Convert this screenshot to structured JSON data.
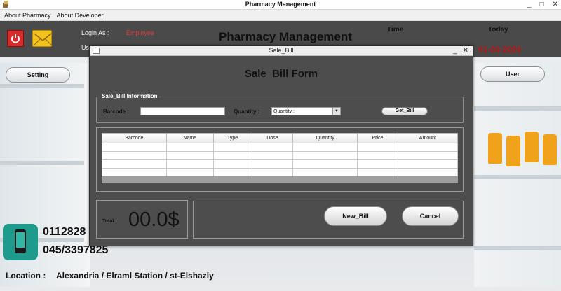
{
  "window": {
    "title": "Pharmacy Management",
    "controls": [
      "_",
      "□",
      "✕"
    ]
  },
  "menu": {
    "items": [
      "About Pharmacy",
      "About Developer"
    ]
  },
  "header": {
    "login_label": "Login As :",
    "login_role": "Employee",
    "user_label_partial": "Us",
    "app_title": "Pharmacy Management",
    "time_label": "Time",
    "today_label": "Today",
    "date": "01-04-2020"
  },
  "side": {
    "setting_label": "Setting",
    "user_label": "User"
  },
  "contact": {
    "phone1_partial": "0112828",
    "phone2": "045/3397825",
    "location_label": "Location :",
    "location_value": "Alexandria / Elraml Station / st-Elshazly"
  },
  "dialog": {
    "title": "Sale_Bill",
    "controls": [
      "_",
      "✕"
    ],
    "heading": "Sale_Bill Form",
    "info_legend": "Sale_Bill Information",
    "barcode_label": "Barcode :",
    "barcode_value": "",
    "quantity_label": "Quantity :",
    "quantity_selected": "Quantity :",
    "get_bill_label": "Get_Bill",
    "table": {
      "columns": [
        "Barcode",
        "Name",
        "Type",
        "Dose",
        "Quantity",
        "Price",
        "Amount"
      ],
      "rows": [
        [
          "",
          "",
          "",
          "",
          "",
          "",
          ""
        ],
        [
          "",
          "",
          "",
          "",
          "",
          "",
          ""
        ],
        [
          "",
          "",
          "",
          "",
          "",
          "",
          ""
        ],
        [
          "",
          "",
          "",
          "",
          "",
          "",
          ""
        ]
      ]
    },
    "total_label": "Total :",
    "total_value": "00.0$",
    "new_bill_label": "New_Bill",
    "cancel_label": "Cancel"
  },
  "colors": {
    "header_bg": "#4a4a4a",
    "dialog_bg": "#4d4d4d",
    "role_text": "#e23a3a",
    "date_text": "#c01212",
    "power_button": "#d42b2b",
    "mail_button": "#f3c21c",
    "phone_icon": "#1e9b8c"
  }
}
